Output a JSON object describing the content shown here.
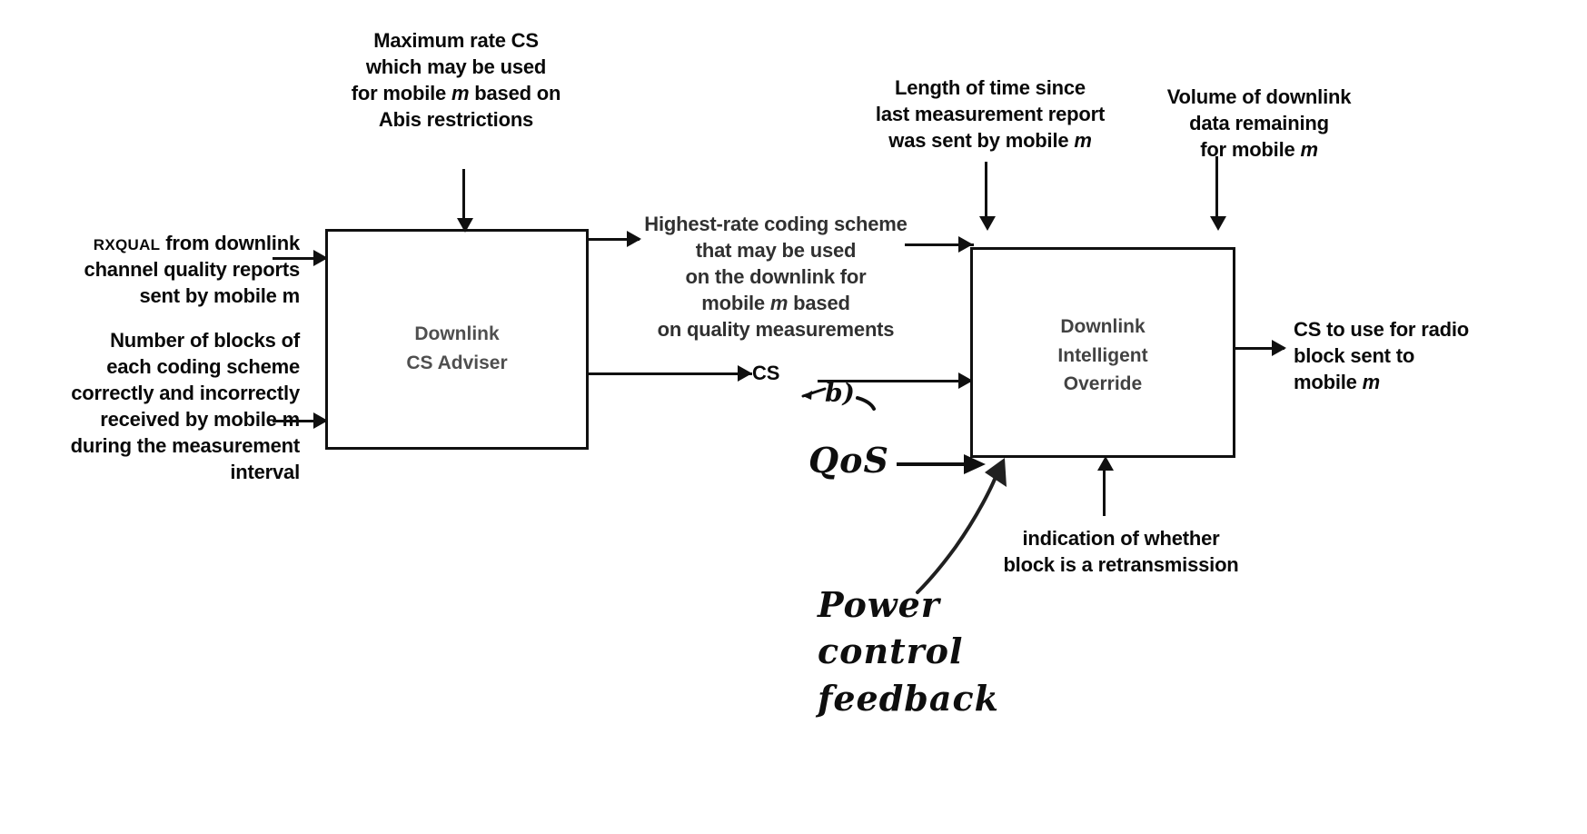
{
  "diagram": {
    "title": "Downlink coding scheme selection block diagram",
    "boxes": [
      {
        "id": "cs-adviser",
        "label": "Downlink\nCS Adviser"
      },
      {
        "id": "intelligent-override",
        "label": "Downlink\nIntelligent\nOverride"
      }
    ],
    "inputs": {
      "top_left": "Maximum rate CS\nwhich may be used\nfor mobile m based on\nAbis restrictions",
      "left_upper_prefix": "RXQUAL",
      "left_upper_rest": " from downlink\nchannel quality reports\nsent by mobile m",
      "left_lower": "Number of blocks of\neach coding scheme\ncorrectly and incorrectly\nreceived by mobile m\nduring the measurement\ninterval",
      "top_mid": "Length of time since\nlast measurement report\nwas sent by mobile m",
      "top_right": "Volume of downlink\ndata remaining\nfor mobile m",
      "bottom_mid": "indication of whether\nblock is a retransmission"
    },
    "middle": {
      "flow_label": "Highest-rate coding scheme\nthat may be used\non the downlink for\nmobile m based\non quality measurements",
      "cs_label": "CS"
    },
    "output": {
      "right": "CS to use for radio\nblock sent to\nmobile m"
    },
    "annotations": [
      {
        "id": "b-marker",
        "text": "b)"
      },
      {
        "id": "qos",
        "text": "QoS"
      },
      {
        "id": "power-control-feedback",
        "text": "Power\ncontrol\nfeedback"
      }
    ],
    "colors": {
      "ink": "#121212",
      "paper": "#ffffff",
      "faded_ink": "#2a2a2a"
    }
  }
}
